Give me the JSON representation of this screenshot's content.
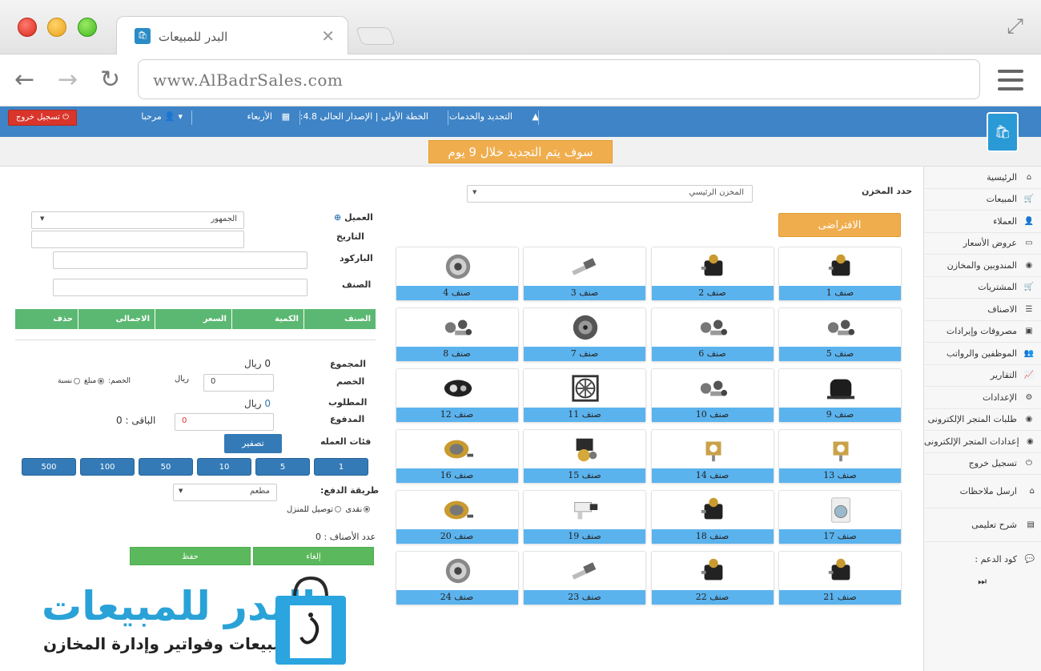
{
  "browser": {
    "tab_title": "البدر للمبيعات",
    "tab_close": "✕",
    "url": "www.AlBadrSales.com",
    "back": "←",
    "forward": "→",
    "reload": "↻"
  },
  "topbar": {
    "renew_services": "التجديد والخدمات",
    "plan": "الخطة الأولى | الإصدار الحالى 4.8:",
    "day": "الأربعاء",
    "welcome": "مرحبا",
    "logout": "تسجيل خروج"
  },
  "notice": "سوف يتم التجديد خلال 9 يوم",
  "sidebar": {
    "items": [
      {
        "label": "الرئيسية",
        "icon": "home-icon",
        "glyph": "⌂"
      },
      {
        "label": "المبيعات",
        "icon": "cart-icon",
        "glyph": "🛒"
      },
      {
        "label": "العملاء",
        "icon": "user-icon",
        "glyph": "👤"
      },
      {
        "label": "عروض الأسعار",
        "icon": "card-icon",
        "glyph": "▭"
      },
      {
        "label": "المندوبين والمخازن",
        "icon": "globe-icon",
        "glyph": "◉"
      },
      {
        "label": "المشتريات",
        "icon": "cart-icon",
        "glyph": "🛒"
      },
      {
        "label": "الاصناف",
        "icon": "list-icon",
        "glyph": "☰"
      },
      {
        "label": "مصروفات وإيرادات",
        "icon": "money-icon",
        "glyph": "▣"
      },
      {
        "label": "الموظفين والرواتب",
        "icon": "users-icon",
        "glyph": "👥"
      },
      {
        "label": "التقارير",
        "icon": "chart-icon",
        "glyph": "📈"
      },
      {
        "label": "الإعدادات",
        "icon": "gears-icon",
        "glyph": "⚙"
      },
      {
        "label": "طلبات المتجر الإلكترونى",
        "icon": "globe-icon",
        "glyph": "◉"
      },
      {
        "label": "إعدادات المتجر الإلكترونى",
        "icon": "globe-icon",
        "glyph": "◉"
      },
      {
        "label": "تسجيل خروج",
        "icon": "power-icon",
        "glyph": "⏻"
      }
    ],
    "send_notes": "ارسل ملاحظات",
    "tutorial": "شرح تعليمى",
    "support_code": "كود الدعم :",
    "skip": "⏭"
  },
  "store": {
    "label": "حدد المخزن",
    "selected": "المخزن الرئيسي",
    "default_button": "الافتراضى"
  },
  "products": [
    {
      "label": "صنف 1",
      "kind": "solenoid"
    },
    {
      "label": "صنف 2",
      "kind": "solenoid"
    },
    {
      "label": "صنف 3",
      "kind": "spark"
    },
    {
      "label": "صنف 4",
      "kind": "filter"
    },
    {
      "label": "صنف 5",
      "kind": "parts"
    },
    {
      "label": "صنف 6",
      "kind": "parts"
    },
    {
      "label": "صنف 7",
      "kind": "pulley"
    },
    {
      "label": "صنف 8",
      "kind": "parts"
    },
    {
      "label": "صنف 9",
      "kind": "compressor"
    },
    {
      "label": "صنف 10",
      "kind": "parts"
    },
    {
      "label": "صنف 11",
      "kind": "fan"
    },
    {
      "label": "صنف 12",
      "kind": "lamp"
    },
    {
      "label": "صنف 13",
      "kind": "timer"
    },
    {
      "label": "صنف 14",
      "kind": "timer"
    },
    {
      "label": "صنف 15",
      "kind": "pump"
    },
    {
      "label": "صنف 16",
      "kind": "motor"
    },
    {
      "label": "صنف 17",
      "kind": "washer"
    },
    {
      "label": "صنف 18",
      "kind": "solenoid"
    },
    {
      "label": "صنف 19",
      "kind": "valve"
    },
    {
      "label": "صنف 20",
      "kind": "motor"
    },
    {
      "label": "صنف 21",
      "kind": "solenoid"
    },
    {
      "label": "صنف 22",
      "kind": "solenoid"
    },
    {
      "label": "صنف 23",
      "kind": "spark"
    },
    {
      "label": "صنف 24",
      "kind": "filter"
    }
  ],
  "form": {
    "customer_label": "العميل",
    "customer_value": "الجمهور",
    "date_label": "التاريخ",
    "barcode_label": "الباركود",
    "item_label": "الصنف",
    "cart_headers": [
      "الصنف",
      "الكمية",
      "السعر",
      "الاجمالى",
      "حذف"
    ],
    "total_label": "المجموع",
    "total_value": "0",
    "currency": "ريال",
    "discount_label": "الخصم",
    "discount_value": "0",
    "discount_currency": "ريال",
    "discount_type_label": "الخصم:",
    "discount_fixed": "مبلغ",
    "discount_percent": "نسبة",
    "required_label": "المطلوب",
    "required_value": "0",
    "paid_label": "المدفوع",
    "paid_value": "0",
    "remaining": "الباقى : 0",
    "denominations_label": "فئات العمله",
    "zero_button": "تصفير",
    "coins": [
      "1",
      "5",
      "10",
      "50",
      "100",
      "500"
    ],
    "payment_label": "طريقة الدفع:",
    "payment_value": "مطعم",
    "cash": "نقدى",
    "delivery": "توصيل للمنزل",
    "items_count": "عدد الأصناف : 0",
    "cancel_button": "إلغاء",
    "save_button": "حفظ"
  },
  "promo": {
    "title": "البدر للمبيعات",
    "subtitle": "برنامج مبيعات وفواتير وإدارة المخازن"
  },
  "colors": {
    "appbar": "#3e84c6",
    "notice": "#f0ad4e",
    "card_caption": "#5bb3ee",
    "cart_header": "#5bb872",
    "coin": "#337ab7",
    "brand": "#29a2d8"
  }
}
